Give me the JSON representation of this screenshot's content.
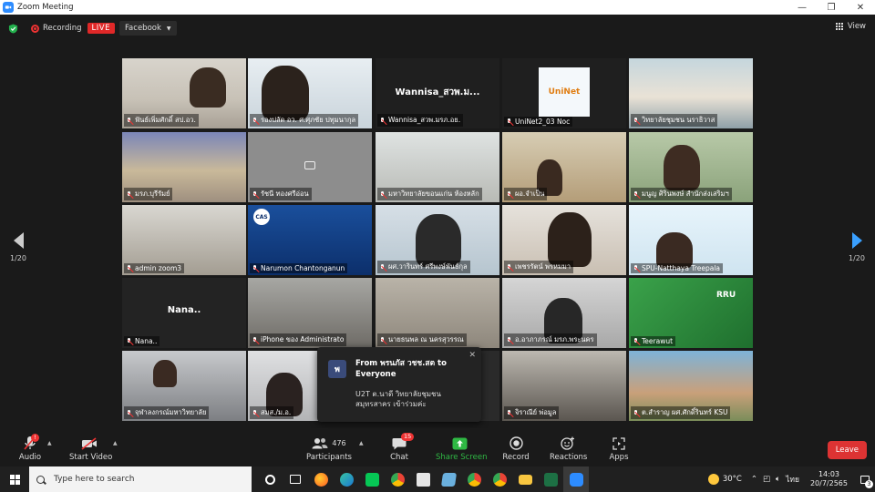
{
  "window": {
    "title": "Zoom Meeting"
  },
  "meeting_bar": {
    "recording_label": "Recording",
    "live_label": "LIVE",
    "stream_target": "Facebook",
    "view_label": "View"
  },
  "pagination": {
    "left_page": "1/20",
    "right_page": "1/20"
  },
  "tiles": [
    {
      "name": "ฟันธ์เพิ่มศักดิ์ สป.อว."
    },
    {
      "name": "รองปลัด อว. ศ.ศุภชัย ปทุมนากุล"
    },
    {
      "name": "Wannisa_สวพ.มรภ.อย.",
      "big": "Wannisa_สวพ.ม..."
    },
    {
      "name": "UniNet2_03 Noc",
      "logo": "UniNet"
    },
    {
      "name": "วิทยาลัยชุมชน นราธิวาส"
    },
    {
      "name": "มรภ.บุรีรัมย์"
    },
    {
      "name": "รัชนี ทองศรีอ่อน"
    },
    {
      "name": "มหาวิทยาลัยขอนแก่น ห้องหลัก"
    },
    {
      "name": "ผอ.จำเป็น"
    },
    {
      "name": "มนูญ ศิรินพงษ์ สำนักส่งเสริมฯ"
    },
    {
      "name": "admin zoom3"
    },
    {
      "name": "Narumon Chantonganun",
      "logo": "CAS"
    },
    {
      "name": "ผศ.วารินทร์ ศรีพงษ์พันธ์กุล"
    },
    {
      "name": "เพชรรัตน์ พรหมมา"
    },
    {
      "name": "SPU-Natthaya Treepala"
    },
    {
      "name": "Nana..",
      "big": "Nana.."
    },
    {
      "name": "iPhone ของ Administrato"
    },
    {
      "name": "นายธนพล ณ นครสุวรรณ"
    },
    {
      "name": "อ.อาภาภรณ์ มรภ.พระนคร"
    },
    {
      "name": "Teerawut",
      "logo": "RRU"
    },
    {
      "name": "จุฬาลงกรณ์มหาวิทยาลัย"
    },
    {
      "name": "สมส./ม.อ."
    },
    {
      "name": ""
    },
    {
      "name": "จิราณีย์ พ่อมูล"
    },
    {
      "name": "ต.สำราญ ผศ.ศักดิ์รินทร์ KSU"
    }
  ],
  "chat_popup": {
    "avatar_letter": "พ",
    "from": "From พรนภัส วชช.สต to Everyone",
    "message": "U2T ต.นาดี  วิทยาลัยชุมชนสมุทรสาคร  เข้าร่วมค่ะ"
  },
  "toolbar": {
    "audio": "Audio",
    "start_video": "Start Video",
    "participants": "Participants",
    "participant_count": "476",
    "chat": "Chat",
    "chat_badge": "15",
    "share_screen": "Share Screen",
    "record": "Record",
    "reactions": "Reactions",
    "apps": "Apps",
    "leave": "Leave"
  },
  "taskbar": {
    "search_placeholder": "Type here to search",
    "weather": "30°C",
    "language": "ไทย",
    "time": "14:03",
    "date": "20/7/2565",
    "notifications": "3"
  },
  "colors": {
    "zoom_blue": "#2d8cff",
    "active_speaker": "#c8e64a",
    "leave_red": "#dd3333",
    "share_green": "#2fb844"
  }
}
